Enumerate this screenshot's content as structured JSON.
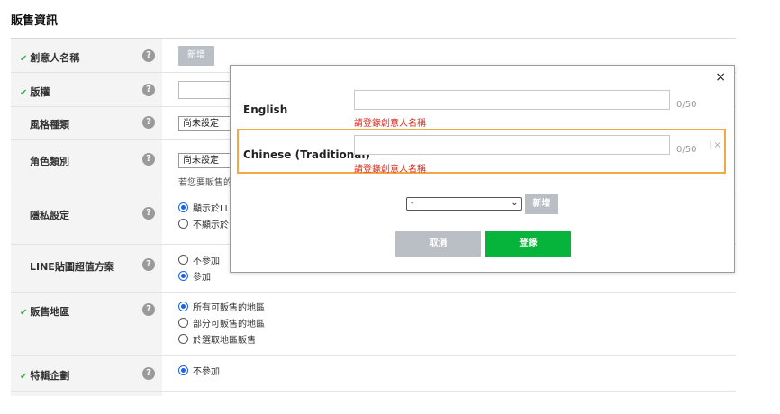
{
  "section_title": "販售資訊",
  "rows": [
    {
      "label": "創意人名稱",
      "checked": true,
      "add_button": "新增"
    },
    {
      "label": "版權",
      "checked": true
    },
    {
      "label": "風格種類",
      "checked": false,
      "select_value": "尚未設定"
    },
    {
      "label": "角色類別",
      "checked": false,
      "select_value": "尚未設定",
      "note": "若您要販售的"
    },
    {
      "label": "隱私設定",
      "checked": false,
      "options": [
        {
          "text": "顯示於LI",
          "selected": true
        },
        {
          "text": "不顯示於",
          "selected": false
        }
      ]
    },
    {
      "label": "LINE貼圖超值方案",
      "checked": false,
      "options": [
        {
          "text": "不參加",
          "selected": false
        },
        {
          "text": "參加",
          "selected": true
        }
      ]
    },
    {
      "label": "販售地區",
      "checked": true,
      "options": [
        {
          "text": "所有可販售的地區",
          "selected": true
        },
        {
          "text": "部分可販售的地區",
          "selected": false
        },
        {
          "text": "於選取地區販售",
          "selected": false
        }
      ]
    },
    {
      "label": "特輯企劃",
      "checked": true,
      "options": [
        {
          "text": "不參加",
          "selected": true
        }
      ]
    }
  ],
  "check_mark": "✔",
  "help_mark": "?",
  "modal": {
    "close_label": "×",
    "english_label": "English",
    "english_value": "",
    "english_count": "0/50",
    "english_error": "請登錄創意人名稱",
    "chinese_label": "Chinese (Traditional)",
    "chinese_value": "",
    "chinese_count": "0/50",
    "chinese_error": "請登錄創意人名稱",
    "remove_label": "×",
    "language_select_value": "-",
    "add_button": "新增",
    "cancel_button": "取消",
    "submit_button": "登錄"
  },
  "colors": {
    "accent_green": "#06b33b",
    "highlight_orange": "#f2a845",
    "error_red": "#e0281e",
    "radio_blue": "#1a63e8"
  }
}
